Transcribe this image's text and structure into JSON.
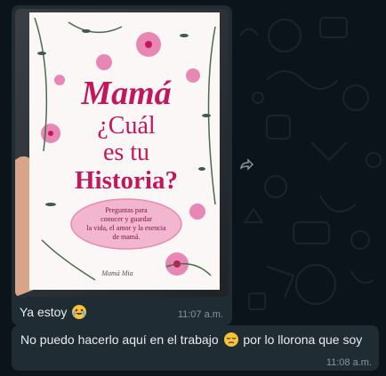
{
  "photo_message": {
    "book": {
      "title_line1": "Mamá",
      "title_line2": "¿Cuál",
      "title_line3": "es tu",
      "title_line4": "Historia?",
      "subtitle_l1": "Preguntas para",
      "subtitle_l2": "conocer y guardar",
      "subtitle_l3": "la vida, el amor y la esencia",
      "subtitle_l4": "de mamá.",
      "brand": "Mamá Mia"
    },
    "caption": "Ya estoy",
    "caption_emoji": "crying-face",
    "time": "11:07 a.m."
  },
  "text_message": {
    "text_before": "No puedo hacerlo aquí en el trabajo",
    "emoji": "pensive-face",
    "text_after": "por lo llorona que soy",
    "time": "11:08 a.m."
  },
  "forward_icon": "forward-icon",
  "colors": {
    "background": "#0b141a",
    "bubble": "#202c33",
    "text": "#e9edef",
    "meta": "#8696a0",
    "title_pink": "#c2185b"
  }
}
